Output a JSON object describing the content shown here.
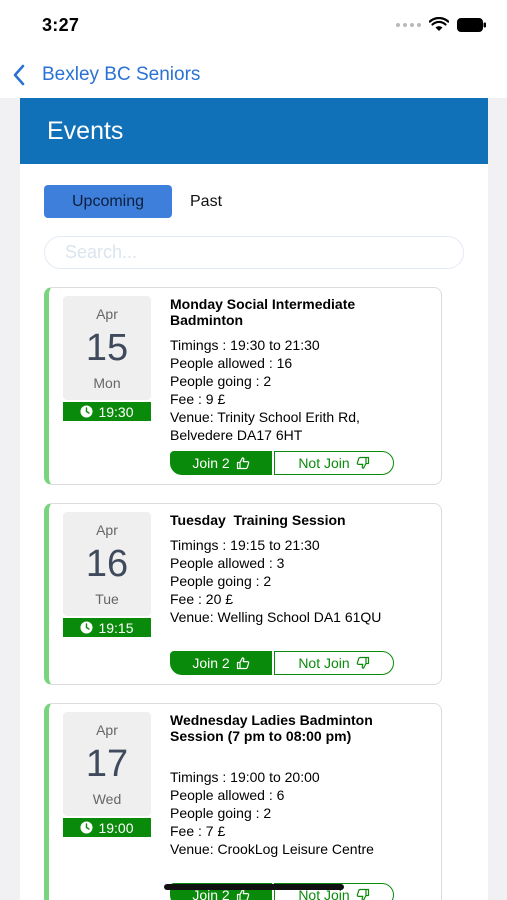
{
  "status_bar": {
    "time": "3:27"
  },
  "nav": {
    "back_label": "Bexley BC Seniors"
  },
  "header": {
    "title": "Events"
  },
  "tabs": {
    "upcoming": "Upcoming",
    "past": "Past"
  },
  "search": {
    "placeholder": "Search..."
  },
  "colors": {
    "header_blue": "#1071b8",
    "tab_active": "#3f7fdc",
    "join_green": "#0a8a0a",
    "card_accent": "#79d37f",
    "nav_link": "#2a72d4"
  },
  "events": [
    {
      "month": "Apr",
      "day": "15",
      "weekday": "Mon",
      "time": "19:30",
      "title": "Monday Social Intermediate Badminton",
      "timings": "Timings : 19:30 to 21:30",
      "allowed": "People allowed : 16",
      "going": "People going : 2",
      "fee": "Fee : 9 £",
      "venue": "Venue: Trinity School Erith Rd, Belvedere DA17 6HT",
      "join_label": "Join 2",
      "not_join_label": "Not Join"
    },
    {
      "month": "Apr",
      "day": "16",
      "weekday": "Tue",
      "time": "19:15",
      "title": "Tuesday  Training Session",
      "timings": "Timings : 19:15 to 21:30",
      "allowed": "People allowed : 3",
      "going": "People going : 2",
      "fee": "Fee : 20 £",
      "venue": "Venue: Welling School DA1 61QU",
      "join_label": "Join 2",
      "not_join_label": "Not Join"
    },
    {
      "month": "Apr",
      "day": "17",
      "weekday": "Wed",
      "time": "19:00",
      "title": "Wednesday Ladies Badminton Session (7 pm to 08:00 pm)",
      "timings": "Timings : 19:00 to 20:00",
      "allowed": "People allowed : 6",
      "going": "People going : 2",
      "fee": "Fee : 7 £",
      "venue": "Venue: CrookLog Leisure Centre",
      "join_label": "Join 2",
      "not_join_label": "Not Join"
    }
  ]
}
